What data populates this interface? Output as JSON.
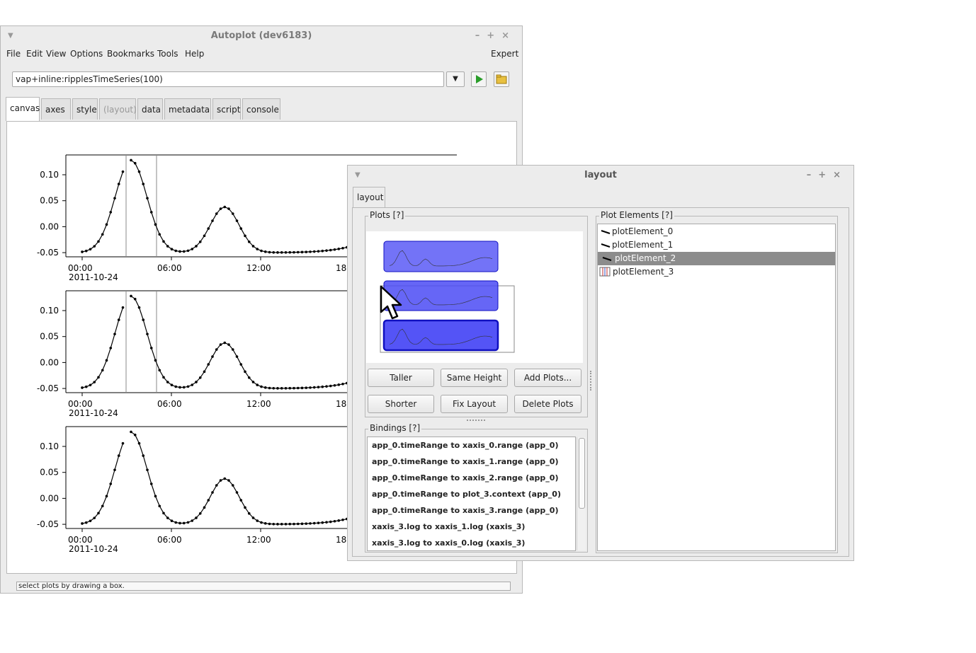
{
  "main_window": {
    "title": "Autoplot (dev6183)",
    "menus": [
      "File",
      "Edit",
      "View",
      "Options",
      "Bookmarks",
      "Tools",
      "Help"
    ],
    "expert_label": "Expert",
    "uri_value": "vap+inline:ripplesTimeSeries(100)",
    "tabs": [
      "canvas",
      "axes",
      "style",
      "(layout)",
      "data",
      "metadata",
      "script",
      "console"
    ],
    "status_text": "select plots by drawing a box."
  },
  "plots": {
    "y_ticks": [
      "0.10",
      "0.05",
      "0.00",
      "-0.05"
    ],
    "x_ticks": [
      "00:00",
      "06:00",
      "12:00",
      "18"
    ],
    "date_label": "2011-10-24"
  },
  "layout_window": {
    "title": "layout",
    "tab": "layout",
    "plots_group": "Plots [?]",
    "plot_elements_group": "Plot Elements [?]",
    "bindings_group": "Bindings [?]",
    "buttons": {
      "taller": "Taller",
      "same_height": "Same Height",
      "add_plots": "Add Plots...",
      "shorter": "Shorter",
      "fix_layout": "Fix Layout",
      "delete_plots": "Delete Plots"
    },
    "plot_elements": [
      "plotElement_0",
      "plotElement_1",
      "plotElement_2",
      "plotElement_3"
    ],
    "selected_element": "plotElement_2",
    "bindings": [
      "app_0.timeRange to xaxis_0.range  (app_0)",
      "app_0.timeRange to xaxis_1.range  (app_0)",
      "app_0.timeRange to xaxis_2.range  (app_0)",
      "app_0.timeRange to plot_3.context  (app_0)",
      "app_0.timeRange to xaxis_3.range  (app_0)",
      "xaxis_3.log to xaxis_1.log  (xaxis_3)",
      "xaxis_3.log to xaxis_0.log  (xaxis_3)"
    ]
  },
  "colors": {
    "selection_blue": "#4b4bf5",
    "selected_row": "#8c8c8c",
    "play_green": "#2a9d2a"
  }
}
